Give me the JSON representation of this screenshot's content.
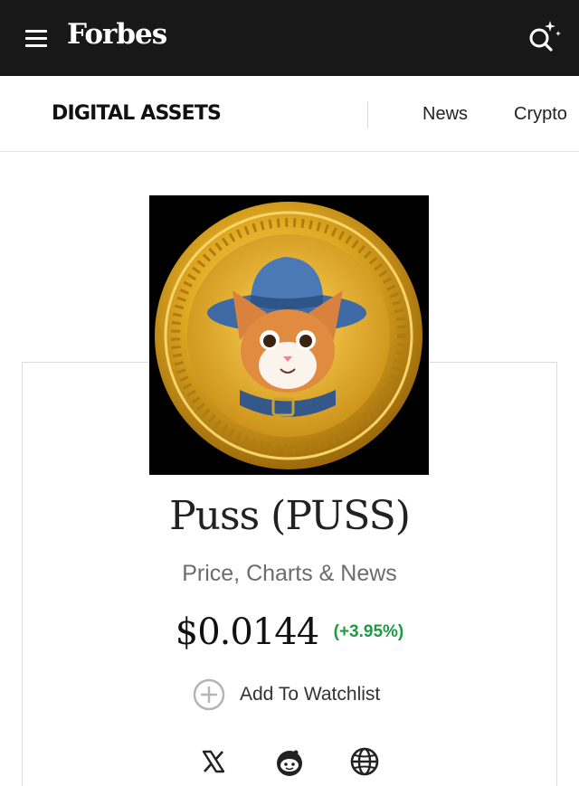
{
  "header": {
    "logo": "Forbes",
    "menu_icon": "hamburger-menu-icon",
    "search_icon": "search-sparkle-icon"
  },
  "subnav": {
    "section_title": "DIGITAL ASSETS",
    "links": [
      "News",
      "Crypto"
    ]
  },
  "coin": {
    "image_icon": "puss-coin-logo",
    "name": "Puss (PUSS)",
    "subtitle": "Price, Charts & News",
    "price": "$0.0144",
    "change": "(+3.95%)",
    "watchlist_label": "Add To Watchlist",
    "change_color": "#1e9a41"
  },
  "socials": [
    "x-icon",
    "reddit-icon",
    "globe-icon"
  ]
}
